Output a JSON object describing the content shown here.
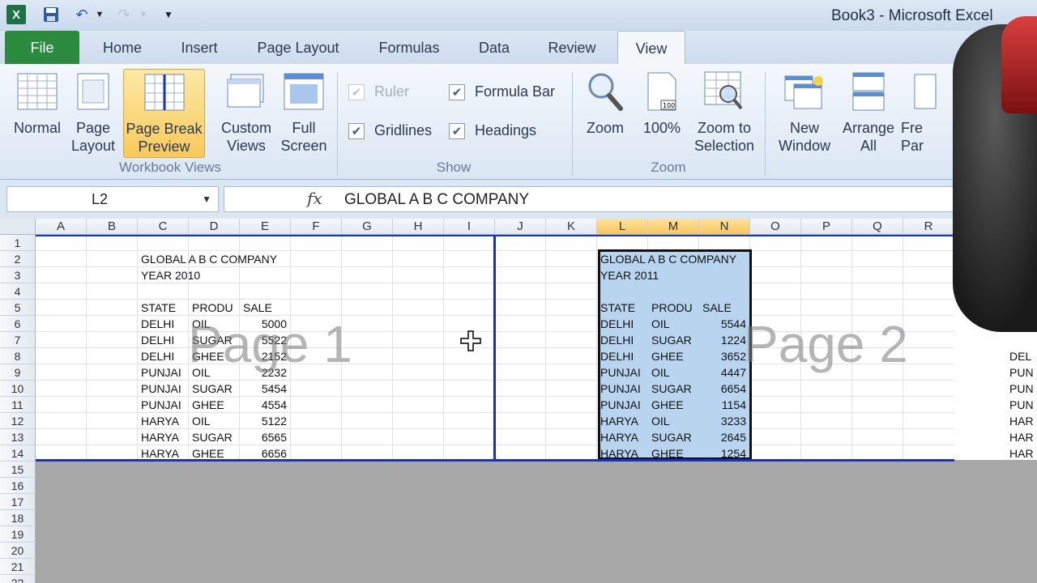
{
  "window": {
    "title": "Book3  -  Microsoft Excel"
  },
  "qat": {
    "logo": "X"
  },
  "tabs": [
    "File",
    "Home",
    "Insert",
    "Page Layout",
    "Formulas",
    "Data",
    "Review",
    "View"
  ],
  "ribbon": {
    "workbook_views": {
      "label": "Workbook Views",
      "buttons": [
        {
          "line1": "Normal",
          "line2": ""
        },
        {
          "line1": "Page",
          "line2": "Layout"
        },
        {
          "line1": "Page Break",
          "line2": "Preview"
        },
        {
          "line1": "Custom",
          "line2": "Views"
        },
        {
          "line1": "Full",
          "line2": "Screen"
        }
      ]
    },
    "show": {
      "label": "Show",
      "ruler": "Ruler",
      "gridlines": "Gridlines",
      "formula_bar": "Formula Bar",
      "headings": "Headings"
    },
    "zoom": {
      "label": "Zoom",
      "zoom": "Zoom",
      "hundred": "100%",
      "selection_line1": "Zoom to",
      "selection_line2": "Selection"
    },
    "window": {
      "new_line1": "New",
      "new_line2": "Window",
      "arrange_line1": "Arrange",
      "arrange_line2": "All",
      "freeze_line1": "Fre",
      "freeze_line2": "Par"
    }
  },
  "formula_bar": {
    "name_box": "L2",
    "fx": "fx",
    "value": "GLOBAL A B C COMPANY"
  },
  "columns": [
    "A",
    "B",
    "C",
    "D",
    "E",
    "F",
    "G",
    "H",
    "I",
    "J",
    "K",
    "L",
    "M",
    "N",
    "O",
    "P",
    "Q",
    "R"
  ],
  "rows": [
    "1",
    "2",
    "3",
    "4",
    "5",
    "6",
    "7",
    "8",
    "9",
    "10",
    "11",
    "12",
    "13",
    "14",
    "15",
    "16",
    "17",
    "18",
    "19",
    "20",
    "21",
    "22"
  ],
  "table1": {
    "title": "GLOBAL A B C COMPANY",
    "year": "YEAR 2010",
    "headers": [
      "STATE",
      "PRODU",
      "SALE"
    ],
    "rows": [
      [
        "DELHI",
        "OIL",
        "5000"
      ],
      [
        "DELHI",
        "SUGAR",
        "5522"
      ],
      [
        "DELHI",
        "GHEE",
        "2152"
      ],
      [
        "PUNJAI",
        "OIL",
        "2232"
      ],
      [
        "PUNJAI",
        "SUGAR",
        "5454"
      ],
      [
        "PUNJAI",
        "GHEE",
        "4554"
      ],
      [
        "HARYA",
        "OIL",
        "5122"
      ],
      [
        "HARYA",
        "SUGAR",
        "6565"
      ],
      [
        "HARYA",
        "GHEE",
        "6656"
      ]
    ]
  },
  "table2": {
    "title": "GLOBAL A B C COMPANY",
    "year": "YEAR 2011",
    "headers": [
      "STATE",
      "PRODU",
      "SALE"
    ],
    "rows": [
      [
        "DELHI",
        "OIL",
        "5544"
      ],
      [
        "DELHI",
        "SUGAR",
        "1224"
      ],
      [
        "DELHI",
        "GHEE",
        "3652"
      ],
      [
        "PUNJAI",
        "OIL",
        "4447"
      ],
      [
        "PUNJAI",
        "SUGAR",
        "6654"
      ],
      [
        "PUNJAI",
        "GHEE",
        "1154"
      ],
      [
        "HARYA",
        "OIL",
        "3233"
      ],
      [
        "HARYA",
        "SUGAR",
        "2645"
      ],
      [
        "HARYA",
        "GHEE",
        "1254"
      ]
    ]
  },
  "edge_cells": [
    "DEL",
    "PUN",
    "PUN",
    "PUN",
    "HAR",
    "HAR",
    "HAR"
  ],
  "watermarks": {
    "page1": "Page 1",
    "page2": "Page 2"
  }
}
